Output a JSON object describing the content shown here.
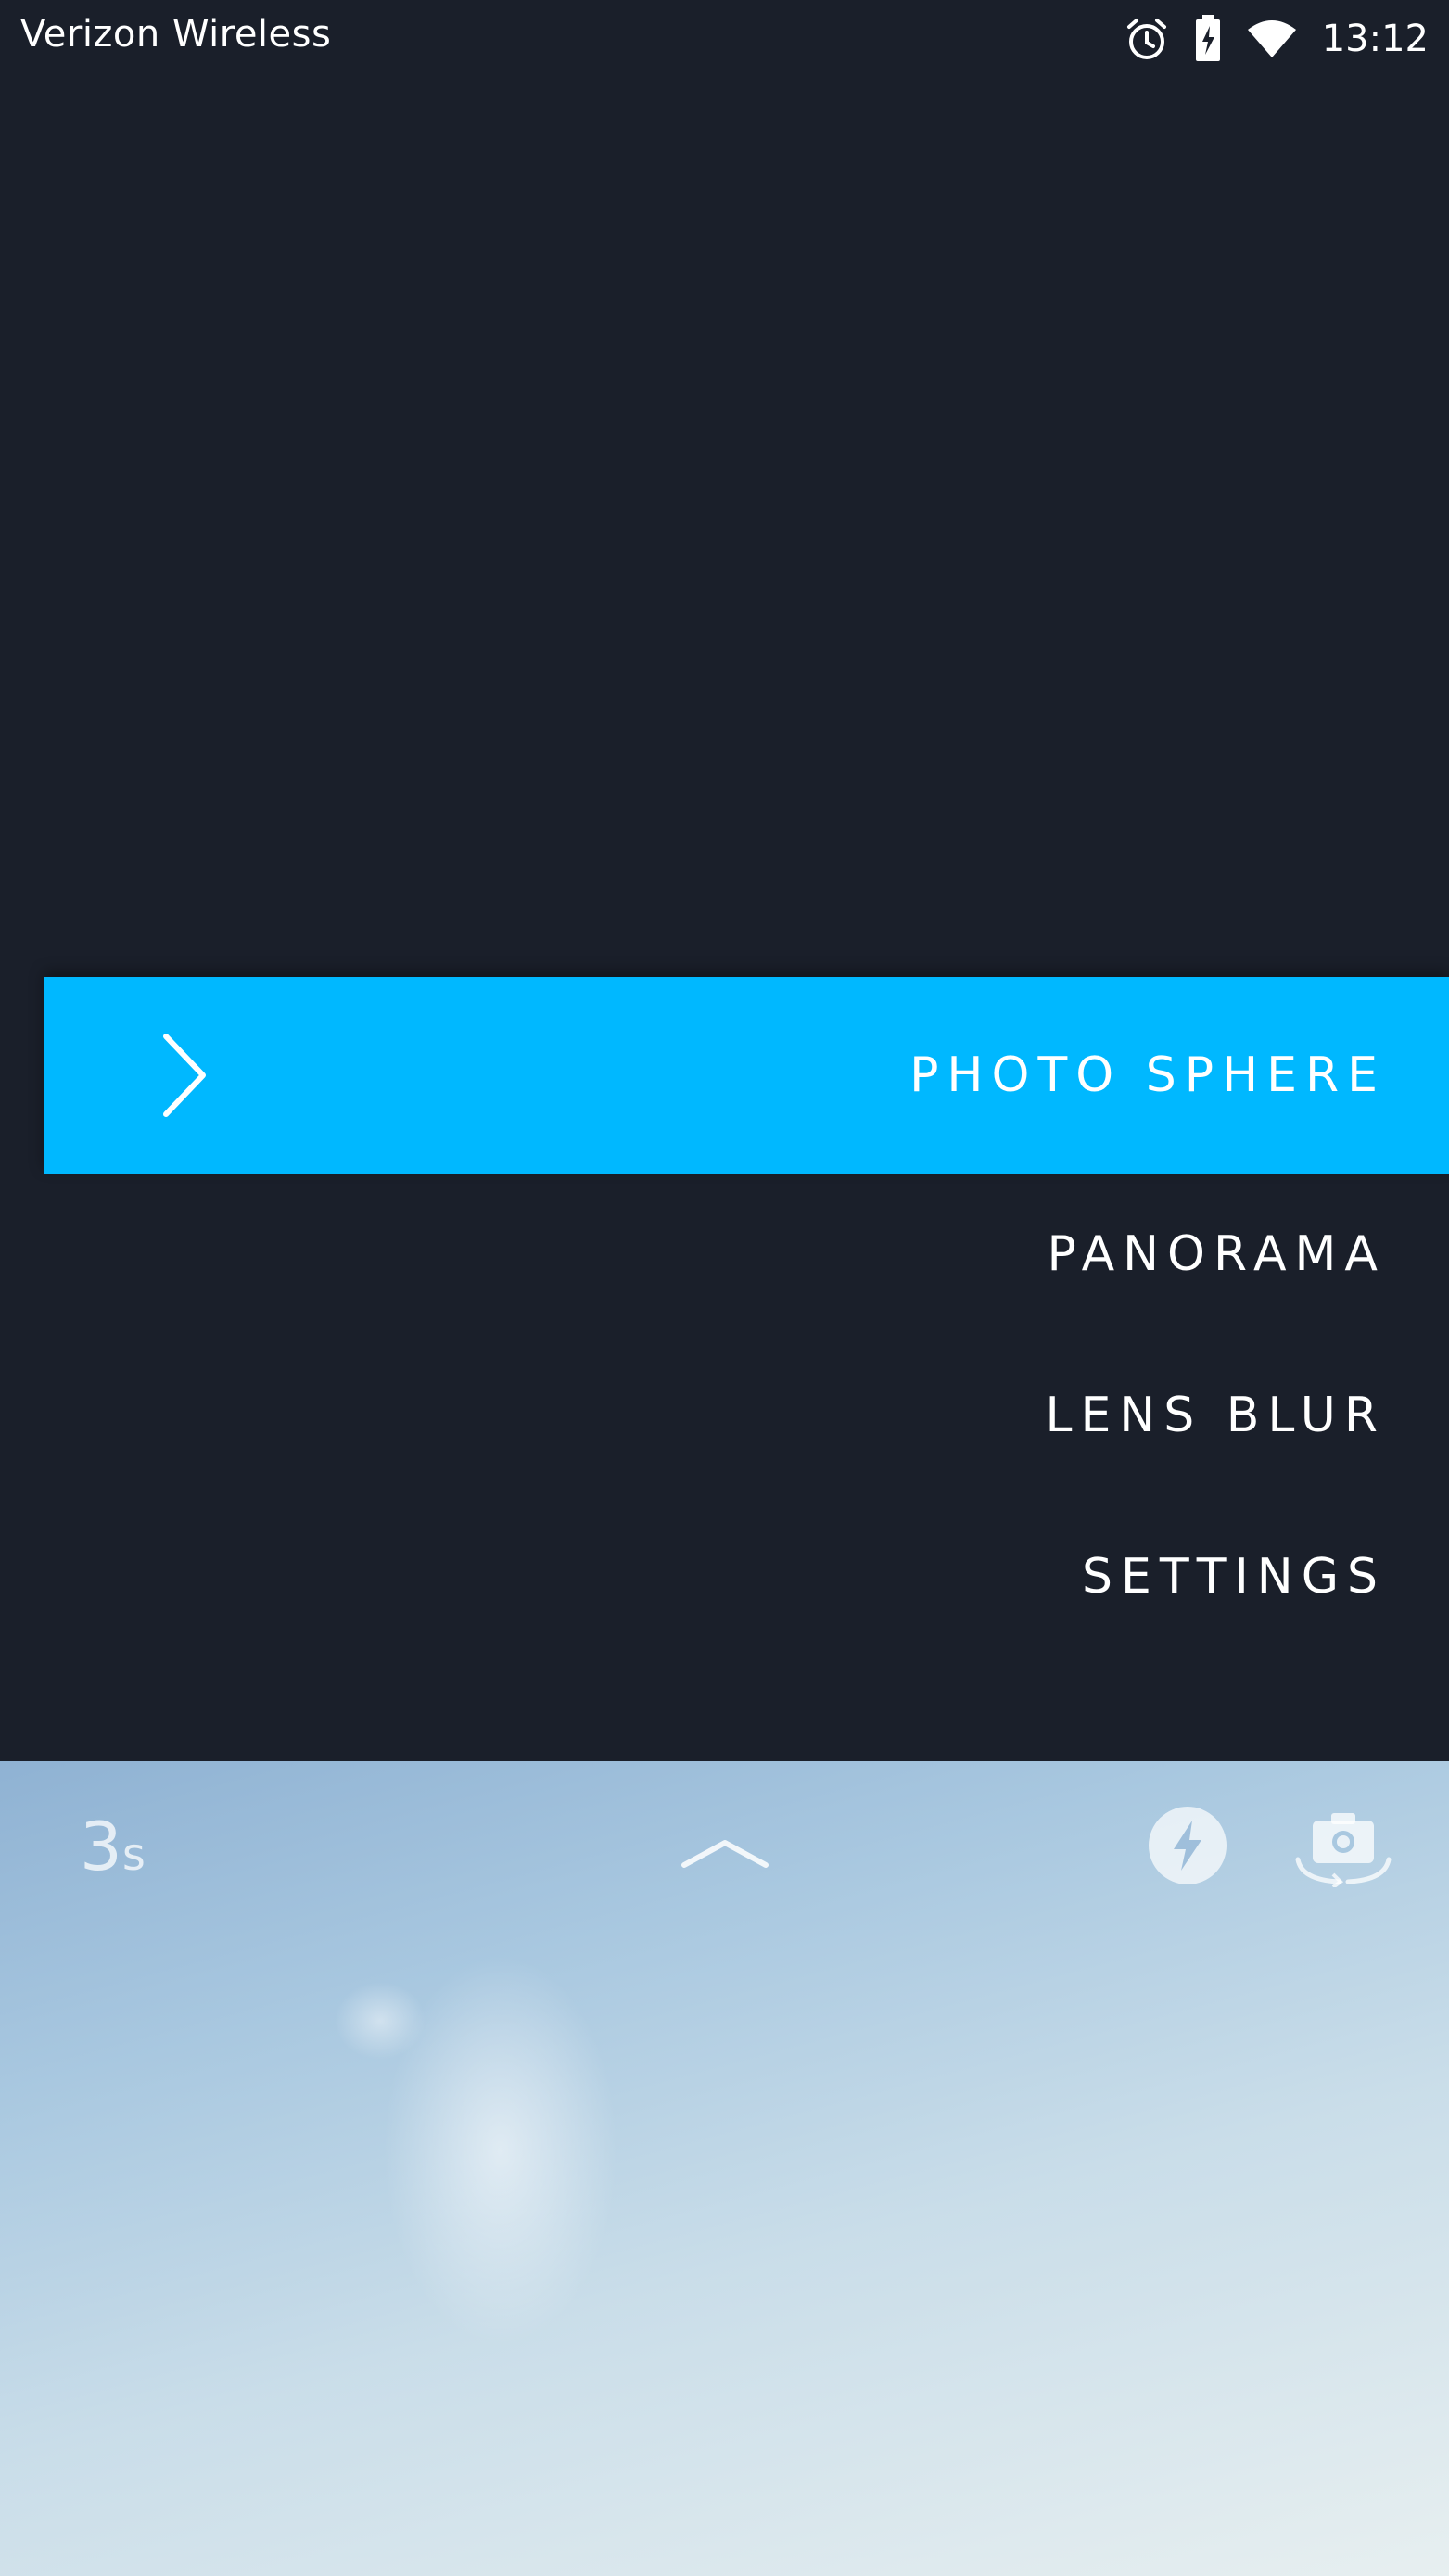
{
  "status_bar": {
    "carrier": "Verizon Wireless",
    "time": "13:12",
    "icons": [
      "alarm-icon",
      "battery-charging-icon",
      "wifi-icon"
    ]
  },
  "menu": {
    "items": [
      {
        "label": "PHOTO SPHERE",
        "active": true,
        "icon": "chevron-right-icon"
      },
      {
        "label": "PANORAMA",
        "active": false
      },
      {
        "label": "LENS BLUR",
        "active": false
      },
      {
        "label": "SETTINGS",
        "active": false
      }
    ]
  },
  "camera_controls": {
    "timer_value": "3",
    "timer_unit": "s",
    "icons": [
      "chevron-up-icon",
      "flash-icon",
      "switch-camera-icon"
    ]
  },
  "colors": {
    "background": "#1a1f2a",
    "accent": "#00b8ff",
    "text": "#ffffff"
  }
}
